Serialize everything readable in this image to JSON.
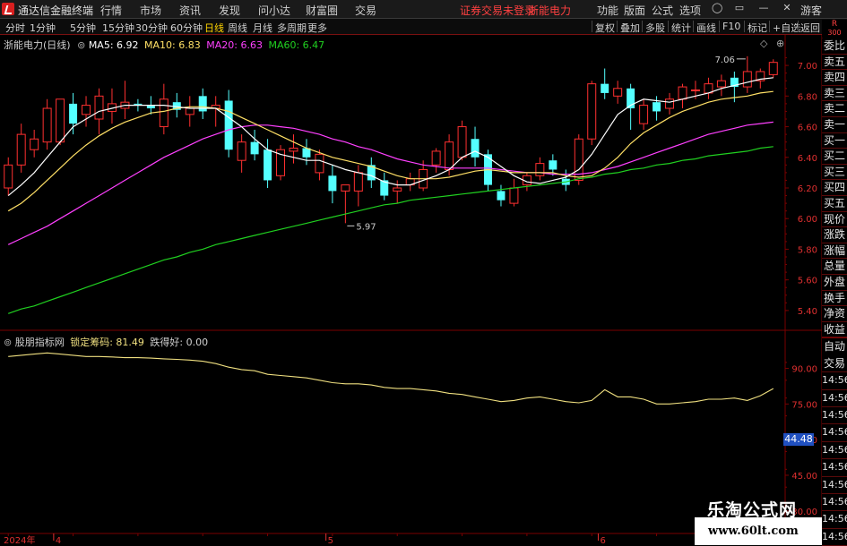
{
  "titlebar": {
    "app_title": "通达信金融终端",
    "menus": [
      "行情",
      "市场",
      "资讯",
      "发现",
      "问小达",
      "财富圈",
      "交易"
    ],
    "status": "证券交易未登录",
    "stock_name": "浙能电力",
    "right_menus": [
      "功能",
      "版面",
      "公式",
      "选项"
    ],
    "guest": "游客"
  },
  "periods": [
    "分时",
    "1分钟",
    "5分钟",
    "15分钟",
    "30分钟",
    "60分钟",
    "日线",
    "周线",
    "月线",
    "多周期",
    "更多"
  ],
  "active_period": "日线",
  "toolbar_right": [
    "复权",
    "叠加",
    "多股",
    "统计",
    "画线",
    "F10",
    "标记",
    "+自选",
    "返回"
  ],
  "main_panel": {
    "stock_label": "浙能电力(日线)",
    "ma5_label": "MA5: 6.92",
    "ma10_label": "MA10: 6.83",
    "ma20_label": "MA20: 6.63",
    "ma60_label": "MA60: 6.47",
    "high_annotation": "7.06",
    "low_annotation": "5.97"
  },
  "sub_panel": {
    "label": "股朋指标网",
    "indicator_label": "锁定筹码: 81.49",
    "indicator2_label": "跌得好: 0.00",
    "current_value": "44.48"
  },
  "x_axis": {
    "year_label": "2024年",
    "month_labels": [
      "4",
      "5",
      "6"
    ]
  },
  "right_column": {
    "top_label_r": "R",
    "top_label_num": "300",
    "items": [
      "委比",
      "卖五",
      "卖四",
      "卖三",
      "卖二",
      "卖一",
      "买一",
      "买二",
      "买三",
      "买四",
      "买五",
      "现价",
      "涨跌",
      "涨幅",
      "总量",
      "外盘",
      "换手",
      "净资",
      "收益",
      "自动",
      "交易",
      "14:56",
      "14:56",
      "14:56",
      "14:56",
      "14:56",
      "14:56",
      "14:56",
      "14:56",
      "14:56",
      "14:56"
    ]
  },
  "watermark": {
    "title": "乐淘公式网",
    "url": "www.60lt.com"
  },
  "colors": {
    "up": "#ff3030",
    "down": "#54ffff",
    "ma5": "#ffffff",
    "ma10": "#ffe066",
    "ma20": "#ff40ff",
    "ma60": "#20d020",
    "indicator": "#f0e080",
    "grid": "#7a0000"
  },
  "chart_data": [
    {
      "type": "candlestick",
      "title": "浙能电力(日线)",
      "ylim": [
        5.3,
        7.1
      ],
      "yticks": [
        7.0,
        6.8,
        6.6,
        6.4,
        6.2,
        6.0,
        5.8,
        5.6,
        5.4
      ],
      "candles": [
        {
          "o": 6.2,
          "h": 6.4,
          "l": 6.15,
          "c": 6.35
        },
        {
          "o": 6.35,
          "h": 6.62,
          "l": 6.3,
          "c": 6.55
        },
        {
          "o": 6.45,
          "h": 6.58,
          "l": 6.4,
          "c": 6.52
        },
        {
          "o": 6.5,
          "h": 6.78,
          "l": 6.45,
          "c": 6.72
        },
        {
          "o": 6.5,
          "h": 6.7,
          "l": 6.48,
          "c": 6.78
        },
        {
          "o": 6.75,
          "h": 6.82,
          "l": 6.55,
          "c": 6.62
        },
        {
          "o": 6.68,
          "h": 6.8,
          "l": 6.6,
          "c": 6.74
        },
        {
          "o": 6.65,
          "h": 6.85,
          "l": 6.55,
          "c": 6.8
        },
        {
          "o": 6.7,
          "h": 6.85,
          "l": 6.62,
          "c": 6.75
        },
        {
          "o": 6.72,
          "h": 6.9,
          "l": 6.65,
          "c": 6.76
        },
        {
          "o": 6.75,
          "h": 6.78,
          "l": 6.7,
          "c": 6.74
        },
        {
          "o": 6.74,
          "h": 6.8,
          "l": 6.68,
          "c": 6.72
        },
        {
          "o": 6.6,
          "h": 6.88,
          "l": 6.55,
          "c": 6.78
        },
        {
          "o": 6.76,
          "h": 6.82,
          "l": 6.66,
          "c": 6.71
        },
        {
          "o": 6.68,
          "h": 6.8,
          "l": 6.6,
          "c": 6.72
        },
        {
          "o": 6.8,
          "h": 6.85,
          "l": 6.65,
          "c": 6.7
        },
        {
          "o": 6.72,
          "h": 6.8,
          "l": 6.6,
          "c": 6.74
        },
        {
          "o": 6.77,
          "h": 6.84,
          "l": 6.4,
          "c": 6.45
        },
        {
          "o": 6.38,
          "h": 6.55,
          "l": 6.3,
          "c": 6.5
        },
        {
          "o": 6.5,
          "h": 6.58,
          "l": 6.38,
          "c": 6.42
        },
        {
          "o": 6.45,
          "h": 6.52,
          "l": 6.2,
          "c": 6.25
        },
        {
          "o": 6.28,
          "h": 6.48,
          "l": 6.25,
          "c": 6.45
        },
        {
          "o": 6.44,
          "h": 6.55,
          "l": 6.36,
          "c": 6.46
        },
        {
          "o": 6.46,
          "h": 6.52,
          "l": 6.35,
          "c": 6.4
        },
        {
          "o": 6.3,
          "h": 6.45,
          "l": 6.25,
          "c": 6.42
        },
        {
          "o": 6.28,
          "h": 6.35,
          "l": 6.1,
          "c": 6.18
        },
        {
          "o": 6.18,
          "h": 6.22,
          "l": 5.97,
          "c": 6.22
        },
        {
          "o": 6.18,
          "h": 6.35,
          "l": 6.08,
          "c": 6.3
        },
        {
          "o": 6.35,
          "h": 6.4,
          "l": 6.2,
          "c": 6.25
        },
        {
          "o": 6.25,
          "h": 6.3,
          "l": 6.12,
          "c": 6.15
        },
        {
          "o": 6.18,
          "h": 6.25,
          "l": 6.1,
          "c": 6.2
        },
        {
          "o": 6.22,
          "h": 6.3,
          "l": 6.18,
          "c": 6.26
        },
        {
          "o": 6.2,
          "h": 6.38,
          "l": 6.18,
          "c": 6.32
        },
        {
          "o": 6.35,
          "h": 6.46,
          "l": 6.3,
          "c": 6.44
        },
        {
          "o": 6.32,
          "h": 6.55,
          "l": 6.28,
          "c": 6.5
        },
        {
          "o": 6.4,
          "h": 6.64,
          "l": 6.38,
          "c": 6.6
        },
        {
          "o": 6.52,
          "h": 6.6,
          "l": 6.34,
          "c": 6.4
        },
        {
          "o": 6.42,
          "h": 6.45,
          "l": 6.18,
          "c": 6.22
        },
        {
          "o": 6.18,
          "h": 6.22,
          "l": 6.08,
          "c": 6.12
        },
        {
          "o": 6.1,
          "h": 6.26,
          "l": 6.08,
          "c": 6.2
        },
        {
          "o": 6.22,
          "h": 6.3,
          "l": 6.18,
          "c": 6.28
        },
        {
          "o": 6.28,
          "h": 6.4,
          "l": 6.25,
          "c": 6.36
        },
        {
          "o": 6.38,
          "h": 6.42,
          "l": 6.28,
          "c": 6.32
        },
        {
          "o": 6.26,
          "h": 6.32,
          "l": 6.18,
          "c": 6.22
        },
        {
          "o": 6.25,
          "h": 6.55,
          "l": 6.22,
          "c": 6.52
        },
        {
          "o": 6.52,
          "h": 6.9,
          "l": 6.48,
          "c": 6.88
        },
        {
          "o": 6.88,
          "h": 6.98,
          "l": 6.78,
          "c": 6.82
        },
        {
          "o": 6.8,
          "h": 6.9,
          "l": 6.75,
          "c": 6.85
        },
        {
          "o": 6.85,
          "h": 6.88,
          "l": 6.58,
          "c": 6.72
        },
        {
          "o": 6.62,
          "h": 6.78,
          "l": 6.58,
          "c": 6.74
        },
        {
          "o": 6.76,
          "h": 6.8,
          "l": 6.64,
          "c": 6.7
        },
        {
          "o": 6.72,
          "h": 6.82,
          "l": 6.68,
          "c": 6.78
        },
        {
          "o": 6.78,
          "h": 6.88,
          "l": 6.72,
          "c": 6.86
        },
        {
          "o": 6.84,
          "h": 6.9,
          "l": 6.78,
          "c": 6.84
        },
        {
          "o": 6.82,
          "h": 6.92,
          "l": 6.78,
          "c": 6.88
        },
        {
          "o": 6.86,
          "h": 6.94,
          "l": 6.8,
          "c": 6.9
        },
        {
          "o": 6.92,
          "h": 6.96,
          "l": 6.76,
          "c": 6.86
        },
        {
          "o": 6.86,
          "h": 7.06,
          "l": 6.82,
          "c": 6.96
        },
        {
          "o": 6.9,
          "h": 6.98,
          "l": 6.85,
          "c": 6.96
        },
        {
          "o": 6.94,
          "h": 7.04,
          "l": 6.92,
          "c": 7.02
        }
      ],
      "ma5": [
        6.15,
        6.22,
        6.3,
        6.4,
        6.5,
        6.6,
        6.65,
        6.7,
        6.72,
        6.74,
        6.74,
        6.74,
        6.74,
        6.73,
        6.72,
        6.72,
        6.72,
        6.66,
        6.6,
        6.52,
        6.45,
        6.42,
        6.4,
        6.38,
        6.38,
        6.35,
        6.32,
        6.3,
        6.28,
        6.24,
        6.22,
        6.22,
        6.25,
        6.28,
        6.32,
        6.4,
        6.44,
        6.4,
        6.34,
        6.28,
        6.24,
        6.23,
        6.25,
        6.27,
        6.32,
        6.42,
        6.55,
        6.68,
        6.74,
        6.78,
        6.77,
        6.76,
        6.78,
        6.8,
        6.82,
        6.85,
        6.87,
        6.89,
        6.91,
        6.92
      ],
      "ma10": [
        6.05,
        6.1,
        6.17,
        6.25,
        6.33,
        6.41,
        6.48,
        6.54,
        6.59,
        6.63,
        6.66,
        6.69,
        6.7,
        6.72,
        6.73,
        6.73,
        6.72,
        6.7,
        6.66,
        6.62,
        6.58,
        6.54,
        6.5,
        6.46,
        6.43,
        6.4,
        6.38,
        6.36,
        6.34,
        6.31,
        6.28,
        6.26,
        6.26,
        6.26,
        6.27,
        6.29,
        6.31,
        6.32,
        6.31,
        6.3,
        6.3,
        6.3,
        6.3,
        6.28,
        6.27,
        6.28,
        6.33,
        6.4,
        6.49,
        6.56,
        6.61,
        6.66,
        6.7,
        6.73,
        6.76,
        6.78,
        6.79,
        6.8,
        6.82,
        6.83
      ],
      "ma20": [
        5.83,
        5.87,
        5.91,
        5.95,
        6.0,
        6.05,
        6.1,
        6.15,
        6.2,
        6.25,
        6.3,
        6.35,
        6.4,
        6.44,
        6.48,
        6.52,
        6.55,
        6.58,
        6.6,
        6.61,
        6.61,
        6.6,
        6.59,
        6.57,
        6.55,
        6.52,
        6.5,
        6.47,
        6.45,
        6.42,
        6.39,
        6.37,
        6.35,
        6.34,
        6.33,
        6.33,
        6.33,
        6.33,
        6.32,
        6.31,
        6.3,
        6.3,
        6.29,
        6.29,
        6.29,
        6.3,
        6.32,
        6.34,
        6.37,
        6.4,
        6.43,
        6.46,
        6.49,
        6.52,
        6.55,
        6.57,
        6.59,
        6.61,
        6.62,
        6.63
      ],
      "ma60": [
        5.38,
        5.41,
        5.43,
        5.46,
        5.49,
        5.52,
        5.55,
        5.58,
        5.61,
        5.64,
        5.67,
        5.7,
        5.73,
        5.75,
        5.78,
        5.8,
        5.83,
        5.85,
        5.87,
        5.89,
        5.91,
        5.93,
        5.95,
        5.97,
        5.99,
        6.01,
        6.03,
        6.05,
        6.07,
        6.09,
        6.1,
        6.12,
        6.13,
        6.14,
        6.15,
        6.16,
        6.17,
        6.18,
        6.19,
        6.2,
        6.21,
        6.22,
        6.23,
        6.24,
        6.26,
        6.27,
        6.29,
        6.3,
        6.32,
        6.33,
        6.35,
        6.36,
        6.38,
        6.39,
        6.41,
        6.42,
        6.43,
        6.44,
        6.46,
        6.47
      ]
    },
    {
      "type": "line",
      "title": "锁定筹码",
      "ylim": [
        22,
        100
      ],
      "yticks": [
        90.0,
        75.0,
        60.0,
        45.0,
        30.0
      ],
      "values": [
        95,
        95.5,
        96,
        96.5,
        96,
        95.5,
        95,
        95,
        94.8,
        94.5,
        94.5,
        94.3,
        94,
        93.8,
        93.5,
        93,
        92,
        90.5,
        89.5,
        89,
        87.5,
        87,
        86.5,
        86,
        85,
        84,
        83.5,
        83.5,
        83,
        82,
        81.5,
        81.5,
        81,
        80.5,
        79.5,
        79,
        78,
        77,
        76,
        76.5,
        77.5,
        78,
        77,
        76,
        75.5,
        76.5,
        81,
        78,
        78,
        77,
        75,
        75,
        75.5,
        76,
        77,
        77,
        77.5,
        76.5,
        78.5,
        81.5
      ]
    }
  ]
}
